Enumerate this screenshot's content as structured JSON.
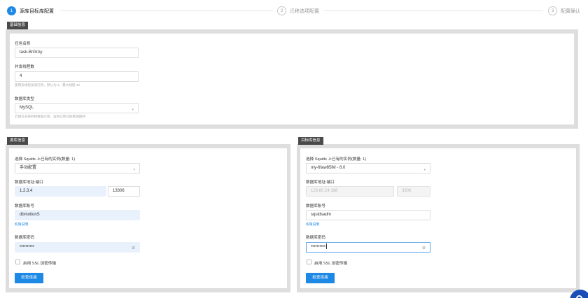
{
  "steps": [
    {
      "num": "1",
      "label": "源库目标库配置",
      "active": true
    },
    {
      "num": "2",
      "label": "迁移选项配置",
      "active": false
    },
    {
      "num": "3",
      "label": "配置确认",
      "active": false
    }
  ],
  "basic": {
    "tag": "基础信息",
    "task_name_label": "任务名称",
    "task_name_value": "task-BrGrAy",
    "concurrency_label": "并发线程数",
    "concurrency_value": "4",
    "concurrency_hint": "使用多线程加速迁移，默认为 4，最大线程 48",
    "dbtype_label": "数据库类型",
    "dbtype_value": "MySQL",
    "dbtype_hint": "云端仅支持同构数据迁移，异构迁移功能敬请期待"
  },
  "source": {
    "tag": "源库信息",
    "instance_label": "选择 Squids 上已有的实例(数量: 1)",
    "instance_value": "手动配置",
    "addr_label": "数据库地址:端口",
    "host_value": "1.2.3.4",
    "port_value": "13306",
    "account_label": "数据库账号",
    "account_value": "dbmotionS",
    "perm_link": "权限说明",
    "password_label": "数据库密码",
    "password_value": "••••••••••",
    "ssl_label": "启用 SSL 加密传输",
    "test_button": "检查连接"
  },
  "target": {
    "tag": "目标库信息",
    "instance_label": "选择 Squids 上已有的实例(数量: 1)",
    "instance_value": "my-6faw85iM - 8.0",
    "addr_label": "数据库地址:端口",
    "host_value": "123.60.24.188",
    "port_value": "3306",
    "account_label": "数据库账号",
    "account_value": "squidsadm",
    "perm_link": "权限说明",
    "password_label": "数据库密码",
    "password_value": "••••••••••",
    "ssl_label": "启用 SSL 加密传输",
    "test_button": "检查连接"
  },
  "icons": {
    "select_caret": "chevron-down-icon",
    "password_toggle": "eye-off-icon",
    "help": "help-bubble-icon"
  },
  "colors": {
    "accent": "#1e88e5",
    "panel_bg": "#dedede",
    "tag_bg": "#4a4a4a",
    "filled_input": "#e9f1fd"
  }
}
